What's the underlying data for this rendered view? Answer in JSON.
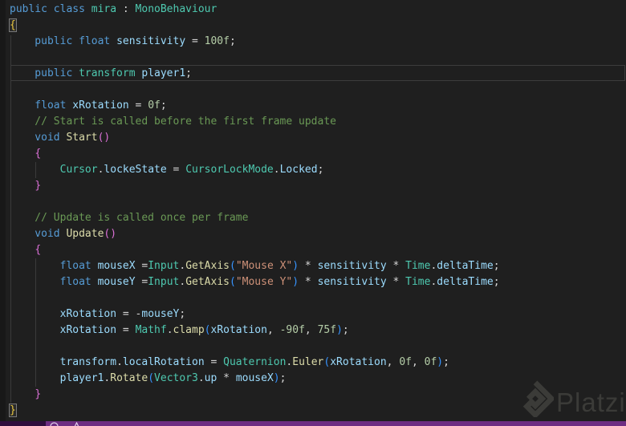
{
  "editor": {
    "background": "#1f1f1f",
    "gutter_background": "#181818",
    "colors": {
      "kw": "#569CD6",
      "type": "#4EC9B0",
      "var": "#9CDCFE",
      "method": "#DCDCAA",
      "str": "#CE9178",
      "num": "#B5CEA8",
      "com": "#6A9955",
      "pun": "#D4D4D4",
      "b1": "#E8C63F",
      "b2": "#DA70D6",
      "b3": "#3794FF"
    },
    "lines": [
      [
        {
          "t": "public class ",
          "c": "kw"
        },
        {
          "t": "mira",
          "c": "type"
        },
        {
          "t": " : ",
          "c": "pun"
        },
        {
          "t": "MonoBehaviour",
          "c": "type"
        }
      ],
      [
        {
          "t": "{",
          "c": "b1box"
        }
      ],
      [
        {
          "t": "    public float ",
          "c": "kw"
        },
        {
          "t": "sensitivity",
          "c": "var"
        },
        {
          "t": " = ",
          "c": "pun"
        },
        {
          "t": "100f",
          "c": "num"
        },
        {
          "t": ";",
          "c": "pun"
        }
      ],
      [],
      [
        {
          "t": "    public ",
          "c": "kw"
        },
        {
          "t": "transform",
          "c": "type"
        },
        {
          "t": " ",
          "c": "pun"
        },
        {
          "t": "player1",
          "c": "var"
        },
        {
          "t": ";",
          "c": "pun"
        }
      ],
      [],
      [
        {
          "t": "    float ",
          "c": "kw"
        },
        {
          "t": "xRotation",
          "c": "var"
        },
        {
          "t": " = ",
          "c": "pun"
        },
        {
          "t": "0f",
          "c": "num"
        },
        {
          "t": ";",
          "c": "pun"
        }
      ],
      [
        {
          "t": "    // Start is called before the first frame update",
          "c": "com"
        }
      ],
      [
        {
          "t": "    void ",
          "c": "kw"
        },
        {
          "t": "Start",
          "c": "method"
        },
        {
          "t": "()",
          "c": "b2"
        }
      ],
      [
        {
          "t": "    ",
          "c": "pun"
        },
        {
          "t": "{",
          "c": "b2"
        }
      ],
      [
        {
          "t": "        ",
          "c": "pun"
        },
        {
          "t": "Cursor",
          "c": "type"
        },
        {
          "t": ".",
          "c": "pun"
        },
        {
          "t": "lockeState",
          "c": "var"
        },
        {
          "t": " = ",
          "c": "pun"
        },
        {
          "t": "CursorLockMode",
          "c": "type"
        },
        {
          "t": ".",
          "c": "pun"
        },
        {
          "t": "Locked",
          "c": "var"
        },
        {
          "t": ";",
          "c": "pun"
        }
      ],
      [
        {
          "t": "    ",
          "c": "pun"
        },
        {
          "t": "}",
          "c": "b2"
        }
      ],
      [],
      [
        {
          "t": "    // Update is called once per frame",
          "c": "com"
        }
      ],
      [
        {
          "t": "    void ",
          "c": "kw"
        },
        {
          "t": "Update",
          "c": "method"
        },
        {
          "t": "()",
          "c": "b2"
        }
      ],
      [
        {
          "t": "    ",
          "c": "pun"
        },
        {
          "t": "{",
          "c": "b2"
        }
      ],
      [
        {
          "t": "        ",
          "c": "pun"
        },
        {
          "t": "float",
          "c": "kw"
        },
        {
          "t": " ",
          "c": "pun"
        },
        {
          "t": "mouseX",
          "c": "var"
        },
        {
          "t": " =",
          "c": "pun"
        },
        {
          "t": "Input",
          "c": "type"
        },
        {
          "t": ".",
          "c": "pun"
        },
        {
          "t": "GetAxis",
          "c": "method"
        },
        {
          "t": "(",
          "c": "b3"
        },
        {
          "t": "\"Mouse X\"",
          "c": "str"
        },
        {
          "t": ")",
          "c": "b3"
        },
        {
          "t": " * ",
          "c": "pun"
        },
        {
          "t": "sensitivity",
          "c": "var"
        },
        {
          "t": " * ",
          "c": "pun"
        },
        {
          "t": "Time",
          "c": "type"
        },
        {
          "t": ".",
          "c": "pun"
        },
        {
          "t": "deltaTime",
          "c": "var"
        },
        {
          "t": ";",
          "c": "pun"
        }
      ],
      [
        {
          "t": "        ",
          "c": "pun"
        },
        {
          "t": "float",
          "c": "kw"
        },
        {
          "t": " ",
          "c": "pun"
        },
        {
          "t": "mouseY",
          "c": "var"
        },
        {
          "t": " =",
          "c": "pun"
        },
        {
          "t": "Input",
          "c": "type"
        },
        {
          "t": ".",
          "c": "pun"
        },
        {
          "t": "GetAxis",
          "c": "method"
        },
        {
          "t": "(",
          "c": "b3"
        },
        {
          "t": "\"Mouse Y\"",
          "c": "str"
        },
        {
          "t": ")",
          "c": "b3"
        },
        {
          "t": " * ",
          "c": "pun"
        },
        {
          "t": "sensitivity",
          "c": "var"
        },
        {
          "t": " * ",
          "c": "pun"
        },
        {
          "t": "Time",
          "c": "type"
        },
        {
          "t": ".",
          "c": "pun"
        },
        {
          "t": "deltaTime",
          "c": "var"
        },
        {
          "t": ";",
          "c": "pun"
        }
      ],
      [],
      [
        {
          "t": "        ",
          "c": "pun"
        },
        {
          "t": "xRotation",
          "c": "var"
        },
        {
          "t": " = -",
          "c": "pun"
        },
        {
          "t": "mouseY",
          "c": "var"
        },
        {
          "t": ";",
          "c": "pun"
        }
      ],
      [
        {
          "t": "        ",
          "c": "pun"
        },
        {
          "t": "xRotation",
          "c": "var"
        },
        {
          "t": " = ",
          "c": "pun"
        },
        {
          "t": "Mathf",
          "c": "type"
        },
        {
          "t": ".",
          "c": "pun"
        },
        {
          "t": "clamp",
          "c": "method"
        },
        {
          "t": "(",
          "c": "b3"
        },
        {
          "t": "xRotation",
          "c": "var"
        },
        {
          "t": ", ",
          "c": "pun"
        },
        {
          "t": "-90f",
          "c": "num"
        },
        {
          "t": ", ",
          "c": "pun"
        },
        {
          "t": "75f",
          "c": "num"
        },
        {
          "t": ")",
          "c": "b3"
        },
        {
          "t": ";",
          "c": "pun"
        }
      ],
      [],
      [
        {
          "t": "        ",
          "c": "pun"
        },
        {
          "t": "transform",
          "c": "var"
        },
        {
          "t": ".",
          "c": "pun"
        },
        {
          "t": "localRotation",
          "c": "var"
        },
        {
          "t": " = ",
          "c": "pun"
        },
        {
          "t": "Quaternion",
          "c": "type"
        },
        {
          "t": ".",
          "c": "pun"
        },
        {
          "t": "Euler",
          "c": "method"
        },
        {
          "t": "(",
          "c": "b3"
        },
        {
          "t": "xRotation",
          "c": "var"
        },
        {
          "t": ", ",
          "c": "pun"
        },
        {
          "t": "0f",
          "c": "num"
        },
        {
          "t": ", ",
          "c": "pun"
        },
        {
          "t": "0f",
          "c": "num"
        },
        {
          "t": ")",
          "c": "b3"
        },
        {
          "t": ";",
          "c": "pun"
        }
      ],
      [
        {
          "t": "        ",
          "c": "pun"
        },
        {
          "t": "player1",
          "c": "var"
        },
        {
          "t": ".",
          "c": "pun"
        },
        {
          "t": "Rotate",
          "c": "method"
        },
        {
          "t": "(",
          "c": "b3"
        },
        {
          "t": "Vector3",
          "c": "type"
        },
        {
          "t": ".",
          "c": "pun"
        },
        {
          "t": "up",
          "c": "var"
        },
        {
          "t": " * ",
          "c": "pun"
        },
        {
          "t": "mouseX",
          "c": "var"
        },
        {
          "t": ")",
          "c": "b3"
        },
        {
          "t": ";",
          "c": "pun"
        }
      ],
      [
        {
          "t": "    ",
          "c": "pun"
        },
        {
          "t": "}",
          "c": "b2"
        }
      ],
      [
        {
          "t": "}",
          "c": "b1box"
        }
      ]
    ]
  },
  "status_bar": {
    "background": "#6E2D82",
    "left_segment_color": "#2F0E3D",
    "icon_color": "#E2D1EC",
    "icons": [
      "errors-circle-icon",
      "warnings-triangle-icon"
    ]
  },
  "watermark": {
    "text": "Platzi",
    "color": "#3B3B38"
  }
}
